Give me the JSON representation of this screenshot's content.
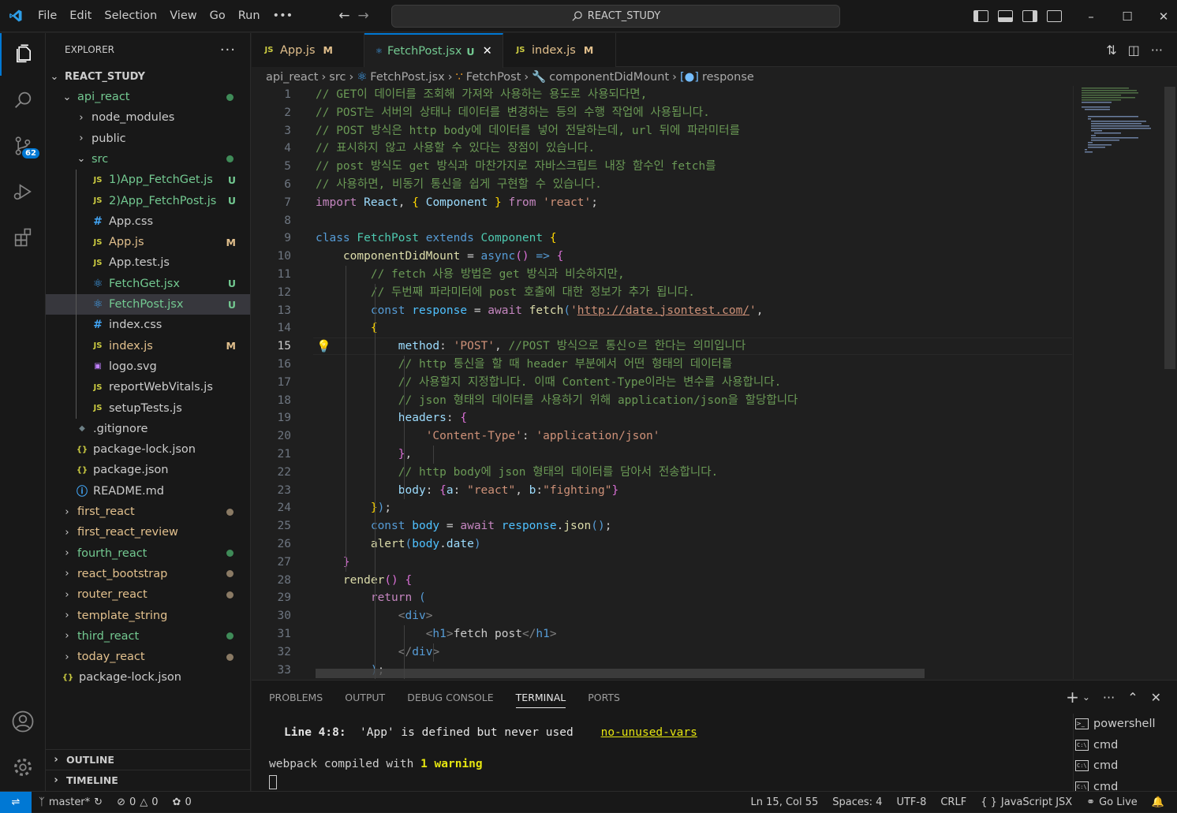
{
  "window": {
    "search_label": "REACT_STUDY"
  },
  "menu": [
    "File",
    "Edit",
    "Selection",
    "View",
    "Go",
    "Run",
    "•••"
  ],
  "activity": {
    "scm_badge": "62"
  },
  "explorer": {
    "title": "EXPLORER",
    "more": "···",
    "root": "REACT_STUDY",
    "items": [
      {
        "label": "api_react",
        "icon": "chevron-down",
        "kind": "folder",
        "status": "dot-green"
      },
      {
        "label": "node_modules",
        "icon": "chevron-right",
        "kind": "folder",
        "status": ""
      },
      {
        "label": "public",
        "icon": "chevron-right",
        "kind": "folder",
        "status": ""
      },
      {
        "label": "src",
        "icon": "chevron-down",
        "kind": "folder",
        "status": "dot-green"
      },
      {
        "label": "1)App_FetchGet.js",
        "icon": "JS",
        "kind": "file",
        "status": "U"
      },
      {
        "label": "2)App_FetchPost.js",
        "icon": "JS",
        "kind": "file",
        "status": "U"
      },
      {
        "label": "App.css",
        "icon": "#",
        "kind": "file",
        "status": ""
      },
      {
        "label": "App.js",
        "icon": "JS",
        "kind": "file",
        "status": "M"
      },
      {
        "label": "App.test.js",
        "icon": "JS",
        "kind": "file",
        "status": ""
      },
      {
        "label": "FetchGet.jsx",
        "icon": "react",
        "kind": "file",
        "status": "U"
      },
      {
        "label": "FetchPost.jsx",
        "icon": "react",
        "kind": "file",
        "status": "U"
      },
      {
        "label": "index.css",
        "icon": "#",
        "kind": "file",
        "status": ""
      },
      {
        "label": "index.js",
        "icon": "JS",
        "kind": "file",
        "status": "M"
      },
      {
        "label": "logo.svg",
        "icon": "svg",
        "kind": "file",
        "status": ""
      },
      {
        "label": "reportWebVitals.js",
        "icon": "JS",
        "kind": "file",
        "status": ""
      },
      {
        "label": "setupTests.js",
        "icon": "JS",
        "kind": "file",
        "status": ""
      },
      {
        "label": ".gitignore",
        "icon": "git",
        "kind": "file",
        "status": ""
      },
      {
        "label": "package-lock.json",
        "icon": "{}",
        "kind": "file",
        "status": ""
      },
      {
        "label": "package.json",
        "icon": "{}",
        "kind": "file",
        "status": ""
      },
      {
        "label": "README.md",
        "icon": "info",
        "kind": "file",
        "status": ""
      },
      {
        "label": "first_react",
        "icon": "chevron-right",
        "kind": "folder",
        "status": "dot-gray"
      },
      {
        "label": "first_react_review",
        "icon": "chevron-right",
        "kind": "folder",
        "status": ""
      },
      {
        "label": "fourth_react",
        "icon": "chevron-right",
        "kind": "folder",
        "status": "dot-green"
      },
      {
        "label": "react_bootstrap",
        "icon": "chevron-right",
        "kind": "folder",
        "status": "dot-gray"
      },
      {
        "label": "router_react",
        "icon": "chevron-right",
        "kind": "folder",
        "status": "dot-gray"
      },
      {
        "label": "template_string",
        "icon": "chevron-right",
        "kind": "folder",
        "status": ""
      },
      {
        "label": "third_react",
        "icon": "chevron-right",
        "kind": "folder",
        "status": "dot-green"
      },
      {
        "label": "today_react",
        "icon": "chevron-right",
        "kind": "folder",
        "status": "dot-gray"
      },
      {
        "label": "package-lock.json",
        "icon": "{}",
        "kind": "file",
        "status": ""
      }
    ],
    "outline": "OUTLINE",
    "timeline": "TIMELINE"
  },
  "tabs": [
    {
      "label": "App.js",
      "icon": "JS",
      "tag": "M"
    },
    {
      "label": "FetchPost.jsx",
      "icon": "react",
      "tag": "U",
      "active": true
    },
    {
      "label": "index.js",
      "icon": "JS",
      "tag": "M"
    }
  ],
  "breadcrumb": [
    "api_react",
    "src",
    "FetchPost.jsx",
    "FetchPost",
    "componentDidMount",
    "response"
  ],
  "editor": {
    "current_line": 15,
    "lines": [
      {
        "n": "1",
        "html": "<span class='c'>// GET이 데이터를 조회해 가져와 사용하는 용도로 사용되다면,</span>"
      },
      {
        "n": "2",
        "html": "<span class='c'>// POST는 서버의 상태나 데이터를 변경하는 등의 수행 작업에 사용됩니다.</span>"
      },
      {
        "n": "3",
        "html": "<span class='c'>// POST 방식은 http body에 데이터를 넣어 전달하는데, url 뒤에 파라미터를</span>"
      },
      {
        "n": "4",
        "html": "<span class='c'>// 표시하지 않고 사용할 수 있다는 장점이 있습니다.</span>"
      },
      {
        "n": "5",
        "html": "<span class='c'>// post 방식도 get 방식과 마찬가지로 자바스크립트 내장 함수인 fetch를</span>"
      },
      {
        "n": "6",
        "html": "<span class='c'>// 사용하면, 비동기 통신을 쉽게 구현할 수 있습니다.</span>"
      },
      {
        "n": "7",
        "html": "<span class='kw'>import</span> <span class='v'>React</span><span class='d'>, </span><span class='y'>{</span> <span class='v'>Component</span> <span class='y'>}</span> <span class='kw'>from</span> <span class='s'>'react'</span><span class='d'>;</span>"
      },
      {
        "n": "8",
        "html": ""
      },
      {
        "n": "9",
        "html": "<span class='k'>class</span> <span class='t'>FetchPost</span> <span class='k'>extends</span> <span class='t'>Component</span> <span class='y'>{</span>"
      },
      {
        "n": "10",
        "html": "    <span class='f'>componentDidMount</span> <span class='d'>=</span> <span class='k'>async</span><span class='p'>()</span> <span class='k'>=&gt;</span> <span class='p'>{</span>"
      },
      {
        "n": "11",
        "html": "        <span class='c'>// fetch 사용 방법은 get 방식과 비슷하지만,</span>"
      },
      {
        "n": "12",
        "html": "        <span class='c'>// 두번째 파라미터에 post 호출에 대한 정보가 추가 됩니다.</span>"
      },
      {
        "n": "13",
        "html": "        <span class='k'>const</span> <span class='cv'>response</span> <span class='d'>=</span> <span class='kw'>await</span> <span class='f'>fetch</span><span class='k'>(</span><span class='s'>'</span><span class='u'>http://date.jsontest.com/</span><span class='s'>'</span><span class='d'>,</span>"
      },
      {
        "n": "14",
        "html": "        <span class='y'>{</span>"
      },
      {
        "n": "15",
        "html": "            <span class='v'>method</span><span class='d'>: </span><span class='s'>'POST'</span><span class='d'>, </span><span class='c'>//POST 방식으로 통신ㅇ르 한다는 의미입니다</span>"
      },
      {
        "n": "16",
        "html": "            <span class='c'>// http 통신을 할 때 header 부분에서 어떤 형태의 데이터를</span>"
      },
      {
        "n": "17",
        "html": "            <span class='c'>// 사용할지 지정합니다. 이때 Content-Type이라는 변수를 사용합니다.</span>"
      },
      {
        "n": "18",
        "html": "            <span class='c'>// json 형태의 데이터를 사용하기 위해 application/json을 할당합니다</span>"
      },
      {
        "n": "19",
        "html": "            <span class='v'>headers</span><span class='d'>: </span><span class='p'>{</span>"
      },
      {
        "n": "20",
        "html": "                <span class='s'>'Content-Type'</span><span class='d'>: </span><span class='s'>'application/json'</span>"
      },
      {
        "n": "21",
        "html": "            <span class='p'>}</span><span class='d'>,</span>"
      },
      {
        "n": "22",
        "html": "            <span class='c'>// http body에 json 형태의 데이터를 담아서 전송합니다.</span>"
      },
      {
        "n": "23",
        "html": "            <span class='v'>body</span><span class='d'>: </span><span class='p'>{</span><span class='v'>a</span><span class='d'>: </span><span class='s'>\"react\"</span><span class='d'>, </span><span class='v'>b</span><span class='d'>:</span><span class='s'>\"fighting\"</span><span class='p'>}</span>"
      },
      {
        "n": "24",
        "html": "        <span class='y'>}</span><span class='k'>)</span><span class='d'>;</span>"
      },
      {
        "n": "25",
        "html": "        <span class='k'>const</span> <span class='cv'>body</span> <span class='d'>=</span> <span class='kw'>await</span> <span class='cv'>response</span><span class='d'>.</span><span class='f'>json</span><span class='k'>()</span><span class='d'>;</span>"
      },
      {
        "n": "26",
        "html": "        <span class='f'>alert</span><span class='k'>(</span><span class='cv'>body</span><span class='d'>.</span><span class='v'>date</span><span class='k'>)</span>"
      },
      {
        "n": "27",
        "html": "    <span class='p'>}</span>"
      },
      {
        "n": "28",
        "html": "    <span class='f'>render</span><span class='p'>()</span> <span class='p'>{</span>"
      },
      {
        "n": "29",
        "html": "        <span class='kw'>return</span> <span class='k'>(</span>"
      },
      {
        "n": "30",
        "html": "            <span class='gray'>&lt;</span><span class='tg'>div</span><span class='gray'>&gt;</span>"
      },
      {
        "n": "31",
        "html": "                <span class='gray'>&lt;</span><span class='tg'>h1</span><span class='gray'>&gt;</span><span class='d'>fetch post</span><span class='gray'>&lt;/</span><span class='tg'>h1</span><span class='gray'>&gt;</span>"
      },
      {
        "n": "32",
        "html": "            <span class='gray'>&lt;/</span><span class='tg'>div</span><span class='gray'>&gt;</span>"
      },
      {
        "n": "33",
        "html": "        <span class='k'>)</span><span class='d'>;</span>"
      }
    ]
  },
  "panel": {
    "tabs": [
      "PROBLEMS",
      "OUTPUT",
      "DEBUG CONSOLE",
      "TERMINAL",
      "PORTS"
    ],
    "active_tab": "TERMINAL",
    "warning_loc": "Line 4:8:",
    "warning_msg": "'App' is defined but never used",
    "warning_rule": "no-unused-vars",
    "compiled_prefix": "webpack compiled with ",
    "compiled_bold": "1 warning",
    "terminals": [
      {
        "label": "powershell",
        "icon": "powershell"
      },
      {
        "label": "cmd",
        "icon": "cmd"
      },
      {
        "label": "cmd",
        "icon": "cmd"
      },
      {
        "label": "cmd",
        "icon": "cmd"
      }
    ]
  },
  "status": {
    "branch": "master*",
    "errors": "0",
    "warnings": "0",
    "ports": "0",
    "position": "Ln 15, Col 55",
    "spaces": "Spaces: 4",
    "encoding": "UTF-8",
    "eol": "CRLF",
    "language": "JavaScript JSX",
    "golive": "Go Live"
  }
}
